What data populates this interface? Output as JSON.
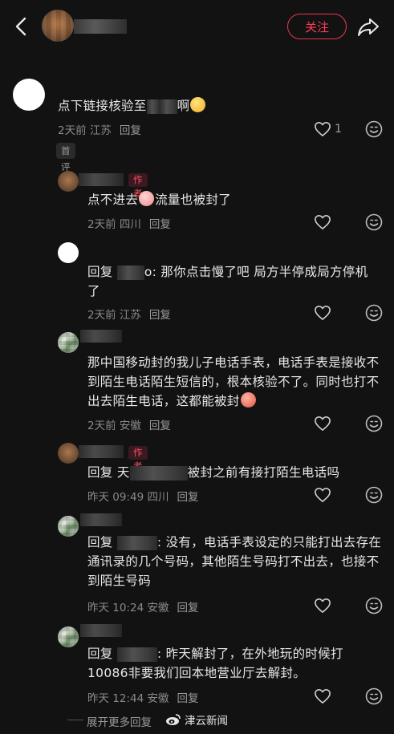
{
  "header": {
    "follow_label": "关注",
    "back_icon": "chevron-left-icon",
    "share_icon": "share-arrow-icon"
  },
  "colors": {
    "background": "#121212",
    "accent": "#ff3b5c",
    "meta_text": "#8a8a8a"
  },
  "comments": [
    {
      "text_before": "点下链接核验至",
      "text_after": "啊",
      "time": "2天前",
      "location": "江苏",
      "reply": "回复",
      "likes": "1",
      "tag": "首评"
    },
    {
      "author_tag": "作者",
      "text_before": "点不进去",
      "text_after": "流量也被封了",
      "time": "2天前",
      "location": "四川",
      "reply": "回复"
    },
    {
      "text_prefix": "回复",
      "text_main": "o: 那你点击慢了吧 局方半停成局方停机了",
      "time": "2天前",
      "location": "江苏",
      "reply": "回复"
    },
    {
      "text": "那中国移动封的我儿子电话手表，电话手表是接收不到陌生电话陌生短信的，根本核验不了。同时也打不出去陌生电话，这都能被封",
      "time": "2天前",
      "location": "安徽",
      "reply": "回复"
    },
    {
      "author_tag": "作者",
      "text_prefix": "回复 天",
      "text_main": "被封之前有接打陌生电话吗",
      "time": "昨天 09:49",
      "location": "四川",
      "reply": "回复"
    },
    {
      "text_prefix": "回复",
      "text_main": ": 没有，电话手表设定的只能打出去存在通讯录的几个号码，其他陌生号码打不出去，也接不到陌生号码",
      "time": "昨天 10:24",
      "location": "安徽",
      "reply": "回复"
    },
    {
      "text_prefix": "回复",
      "text_main": ": 昨天解封了，在外地玩的时候打10086非要我们回本地营业厅去解封。",
      "time": "昨天 12:44",
      "location": "安徽",
      "reply": "回复"
    }
  ],
  "footer": {
    "expand_label": "展开更多回复",
    "watermark": "津云新闻"
  }
}
